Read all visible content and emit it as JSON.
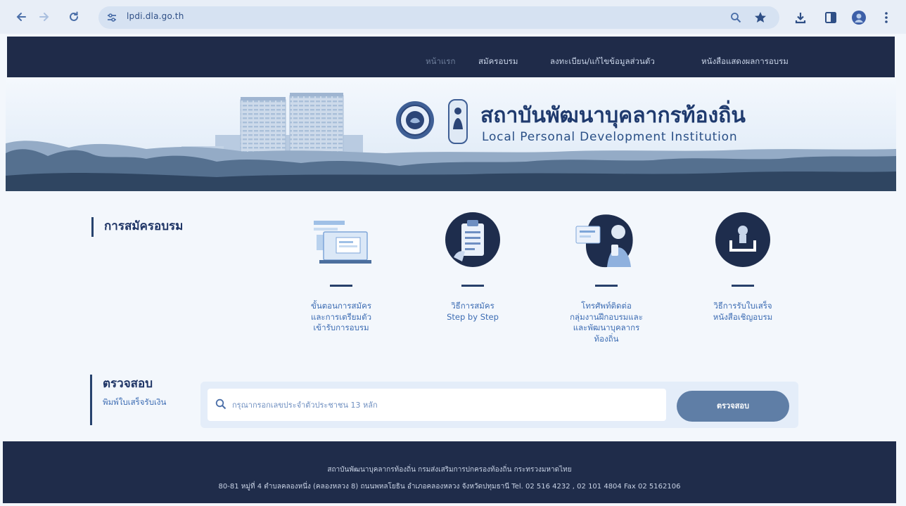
{
  "browser": {
    "url": "lpdi.dla.go.th"
  },
  "nav": {
    "items": [
      {
        "label": "หน้าแรก",
        "active": true
      },
      {
        "label": "สมัครอบรม",
        "active": false
      },
      {
        "label": "ลงทะเบียน/แก้ไขข้อมูลส่วนตัว",
        "active": false
      },
      {
        "label": "หนังสือแสดงผลการอบรม",
        "active": false
      }
    ]
  },
  "header": {
    "title_th": "สถาบันพัฒนาบุคลากรท้องถิ่น",
    "title_en": "Local Personal Development Institution"
  },
  "registration": {
    "heading": "การสมัครอบรม",
    "cards": [
      {
        "icon": "laptop-form-icon",
        "lines": [
          "ขั้นตอนการสมัคร",
          "และการเตรียมตัว",
          "เข้ารับการอบรม"
        ]
      },
      {
        "icon": "clipboard-icon",
        "lines": [
          "วิธีการสมัคร",
          "Step by Step"
        ]
      },
      {
        "icon": "contact-person-icon",
        "lines": [
          "โทรศัพท์ติดต่อ",
          "กลุ่มงานฝึกอบรมและ",
          "และพัฒนาบุคลากร",
          "ท้องถิ่น"
        ]
      },
      {
        "icon": "download-tray-icon",
        "lines": [
          "วิธีการรับใบเสร็จ",
          "หนังสือเชิญอบรม"
        ]
      }
    ]
  },
  "check": {
    "heading": "ตรวจสอบ",
    "subheading": "พิมพ์ใบเสร็จรับเงิน",
    "placeholder": "กรุณากรอกเลขประจำตัวประชาชน 13 หลัก",
    "button": "ตรวจสอบ"
  },
  "footer": {
    "line1": "สถาบันพัฒนาบุคลากรท้องถิ่น กรมส่งเสริมการปกครองท้องถิ่น กระทรวงมหาดไทย",
    "line2": "80-81 หมู่ที่ 4 ตำบลคลองหนึ่ง (คลองหลวง 8) ถนนพหลโยธิน อำเภอคลองหลวง จังหวัดปทุมธานี Tel. 02 516 4232 , 02 101 4804 Fax 02 5162106"
  },
  "colors": {
    "nav_bg": "#1f2b49",
    "footer_bg": "#1f2c4a",
    "accent": "#3c6cb3",
    "heading": "#1f3566",
    "button_bg": "#5f7ea6"
  }
}
